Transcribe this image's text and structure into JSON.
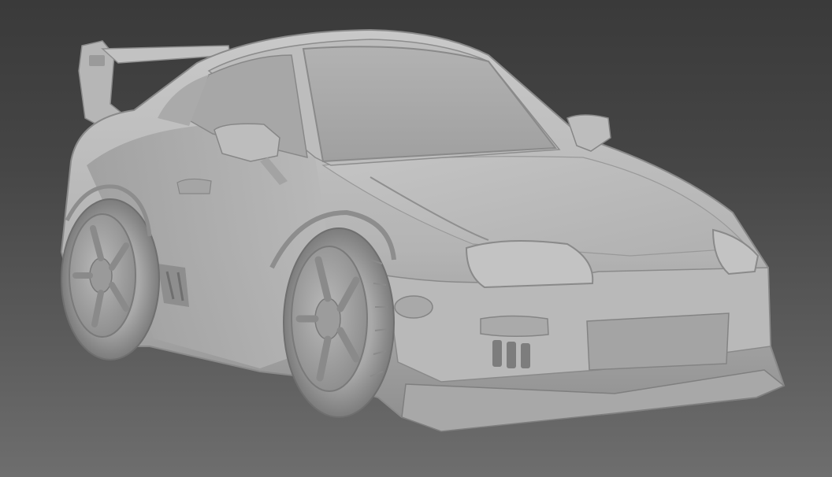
{
  "viewport": {
    "background_top": "#3a3a3a",
    "background_bottom": "#6e6e6e"
  },
  "model": {
    "material_color": "#b8b8b8",
    "shadow_color": "#8a8a8a",
    "highlight_color": "#d4d4d4"
  }
}
